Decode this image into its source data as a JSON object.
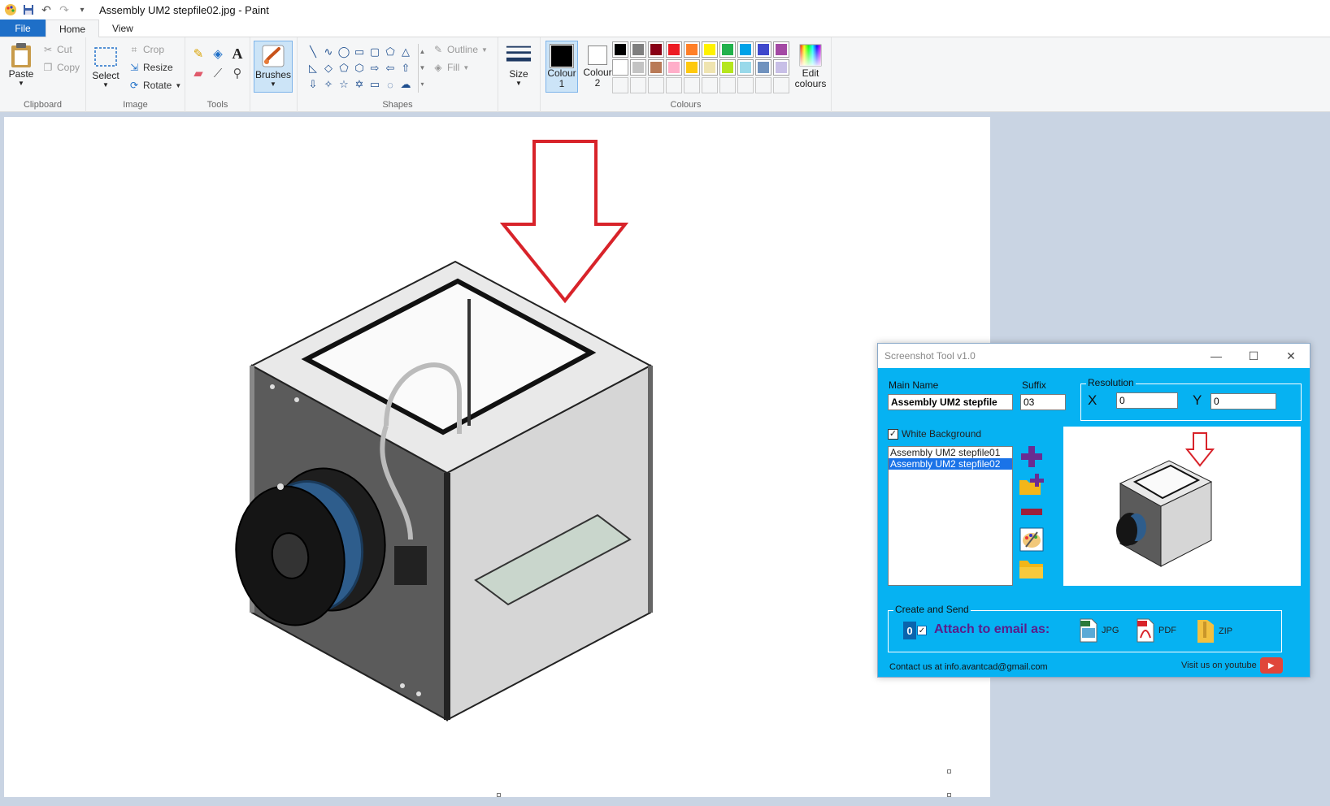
{
  "window": {
    "title": "Assembly UM2 stepfile02.jpg - Paint"
  },
  "quick_access": {
    "icons": [
      "paint-app-icon",
      "save-icon",
      "undo-icon",
      "redo-icon",
      "customize-dropdown-icon"
    ]
  },
  "menu": {
    "file": "File",
    "home": "Home",
    "view": "View"
  },
  "ribbon": {
    "clipboard": {
      "label": "Clipboard",
      "paste": "Paste",
      "cut": "Cut",
      "copy": "Copy"
    },
    "image": {
      "label": "Image",
      "select": "Select",
      "crop": "Crop",
      "resize": "Resize",
      "rotate": "Rotate"
    },
    "tools": {
      "label": "Tools"
    },
    "brushes": {
      "label": "Brushes"
    },
    "shapes": {
      "label": "Shapes",
      "outline": "Outline",
      "fill": "Fill"
    },
    "size": {
      "label": "Size"
    },
    "colours": {
      "label": "Colours",
      "colour1": "Colour 1",
      "colour2": "Colour 2",
      "edit": "Edit colours",
      "colour1_value": "#000000",
      "colour2_value": "#ffffff",
      "row1": [
        "#000000",
        "#7f7f7f",
        "#880015",
        "#ed1c24",
        "#ff7f27",
        "#fff200",
        "#22b14c",
        "#00a2e8",
        "#3f48cc",
        "#a349a4"
      ],
      "row2": [
        "#ffffff",
        "#c3c3c3",
        "#b97a57",
        "#ffaec9",
        "#ffc90e",
        "#efe4b0",
        "#b5e61d",
        "#99d9ea",
        "#7092be",
        "#c8bfe7"
      ]
    }
  },
  "tool_window": {
    "title": "Screenshot Tool v1.0",
    "main_name_label": "Main Name",
    "main_name_value": "Assembly UM2 stepfile",
    "suffix_label": "Suffix",
    "suffix_value": "03",
    "resolution_label": "Resolution",
    "x_label": "X",
    "x_value": "0",
    "y_label": "Y",
    "y_value": "0",
    "white_bg_label": "White Background",
    "white_bg_checked": true,
    "files": [
      "Assembly UM2 stepfile01",
      "Assembly UM2 stepfile02"
    ],
    "selected_file": "Assembly UM2 stepfile02",
    "create_send_label": "Create and Send",
    "attach_label": "Attach to email as:",
    "jpg": "JPG",
    "pdf": "PDF",
    "zip": "ZIP",
    "contact": "Contact us at info.avantcad@gmail.com",
    "youtube": "Visit us on youtube"
  }
}
